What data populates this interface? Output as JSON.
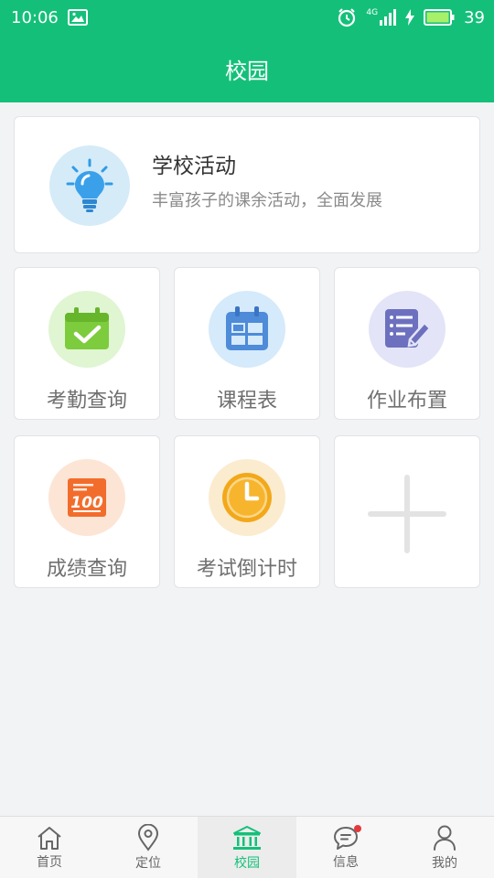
{
  "status_bar": {
    "time": "10:06",
    "network": "4G",
    "battery": "39",
    "icons": [
      "image-icon",
      "alarm-icon",
      "signal-icon",
      "charging-icon",
      "battery-icon"
    ]
  },
  "header": {
    "title": "校园"
  },
  "activity": {
    "title": "学校活动",
    "subtitle": "丰富孩子的课余活动，全面发展",
    "icon": "lightbulb-icon"
  },
  "tiles": [
    {
      "label": "考勤查询",
      "icon": "calendar-check-icon",
      "color": "#7dcc3d"
    },
    {
      "label": "课程表",
      "icon": "timetable-icon",
      "color": "#4e8bd8"
    },
    {
      "label": "作业布置",
      "icon": "homework-icon",
      "color": "#6c70be"
    },
    {
      "label": "成绩查询",
      "icon": "score-icon",
      "color": "#f26d2c"
    },
    {
      "label": "考试倒计时",
      "icon": "clock-icon",
      "color": "#f3a81a"
    },
    {
      "label": "",
      "icon": "plus-icon",
      "color": "#e3e3e3"
    }
  ],
  "bottom_nav": {
    "items": [
      {
        "label": "首页",
        "icon": "home-icon"
      },
      {
        "label": "定位",
        "icon": "location-pin-icon"
      },
      {
        "label": "校园",
        "icon": "campus-icon",
        "active": true
      },
      {
        "label": "信息",
        "icon": "message-icon",
        "has_badge": true
      },
      {
        "label": "我的",
        "icon": "user-icon"
      }
    ]
  },
  "colors": {
    "accent": "#14c079",
    "background": "#f2f3f5",
    "badge": "#e4393c"
  }
}
